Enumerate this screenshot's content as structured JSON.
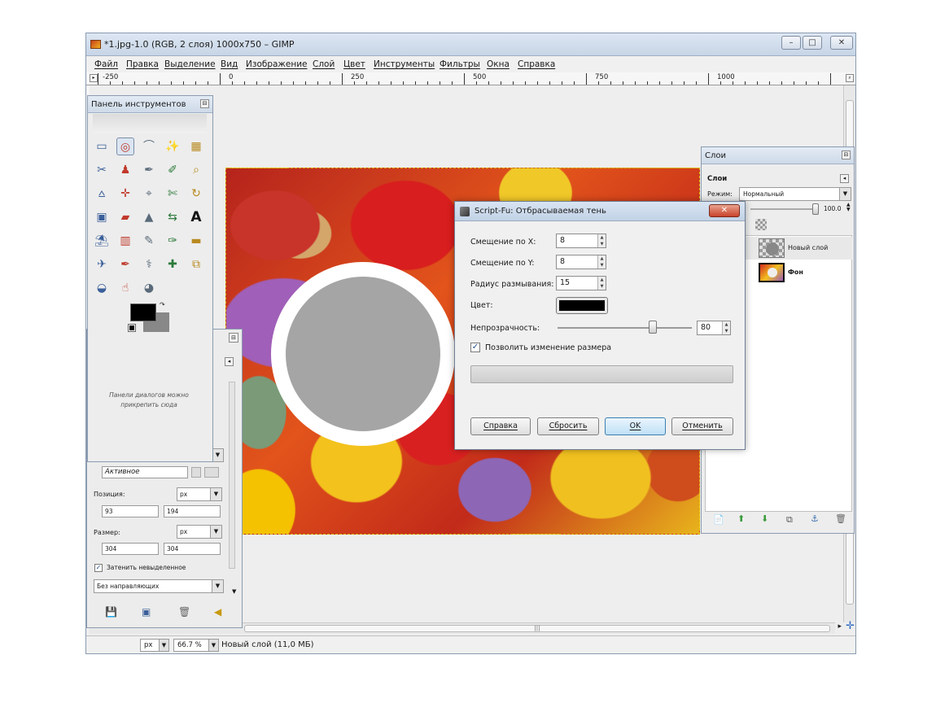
{
  "window": {
    "title": "*1.jpg-1.0 (RGB, 2 слоя) 1000x750 – GIMP",
    "controls": [
      "–",
      "□",
      "✕"
    ]
  },
  "menu": [
    "Файл",
    "Правка",
    "Выделение",
    "Вид",
    "Изображение",
    "Слой",
    "Цвет",
    "Инструменты",
    "Фильтры",
    "Окна",
    "Справка"
  ],
  "ruler": {
    "labels": [
      "-250",
      "0",
      "250",
      "500",
      "750",
      "1000"
    ]
  },
  "toolbox": {
    "title": "Панель инструментов",
    "hint": "Панели диалогов можно прикрепить сюда"
  },
  "tool_options": {
    "mode_value": "Активное",
    "position_label": "Позиция:",
    "unit": "px",
    "pos_x": "93",
    "pos_y": "194",
    "size_label": "Размер:",
    "size_w": "304",
    "size_h": "304",
    "checkbox_label": "Затенить невыделенное",
    "guides_value": "Без направляющих"
  },
  "layers": {
    "title": "Слои",
    "subtitle": "Слои",
    "mode_label": "Режим:",
    "mode_value": "Нормальный",
    "opacity": "100.0",
    "items": [
      {
        "name": "Новый слой"
      },
      {
        "name": "Фон"
      }
    ]
  },
  "dialog": {
    "title": "Script-Fu: Отбрасываемая тень",
    "offset_x_label": "Смещение по X:",
    "offset_x": "8",
    "offset_y_label": "Смещение по Y:",
    "offset_y": "8",
    "blur_label": "Радиус размывания:",
    "blur": "15",
    "color_label": "Цвет:",
    "color": "#000000",
    "opacity_label": "Непрозрачность:",
    "opacity": "80",
    "opacity_fraction": 0.8,
    "resize_label": "Позволить изменение размера",
    "resize_checked": true,
    "buttons": {
      "help": "Справка",
      "reset": "Сбросить",
      "ok": "OK",
      "cancel": "Отменить"
    }
  },
  "status": {
    "unit": "px",
    "zoom": "66.7 %",
    "message": "Новый слой (11,0 МБ)"
  }
}
